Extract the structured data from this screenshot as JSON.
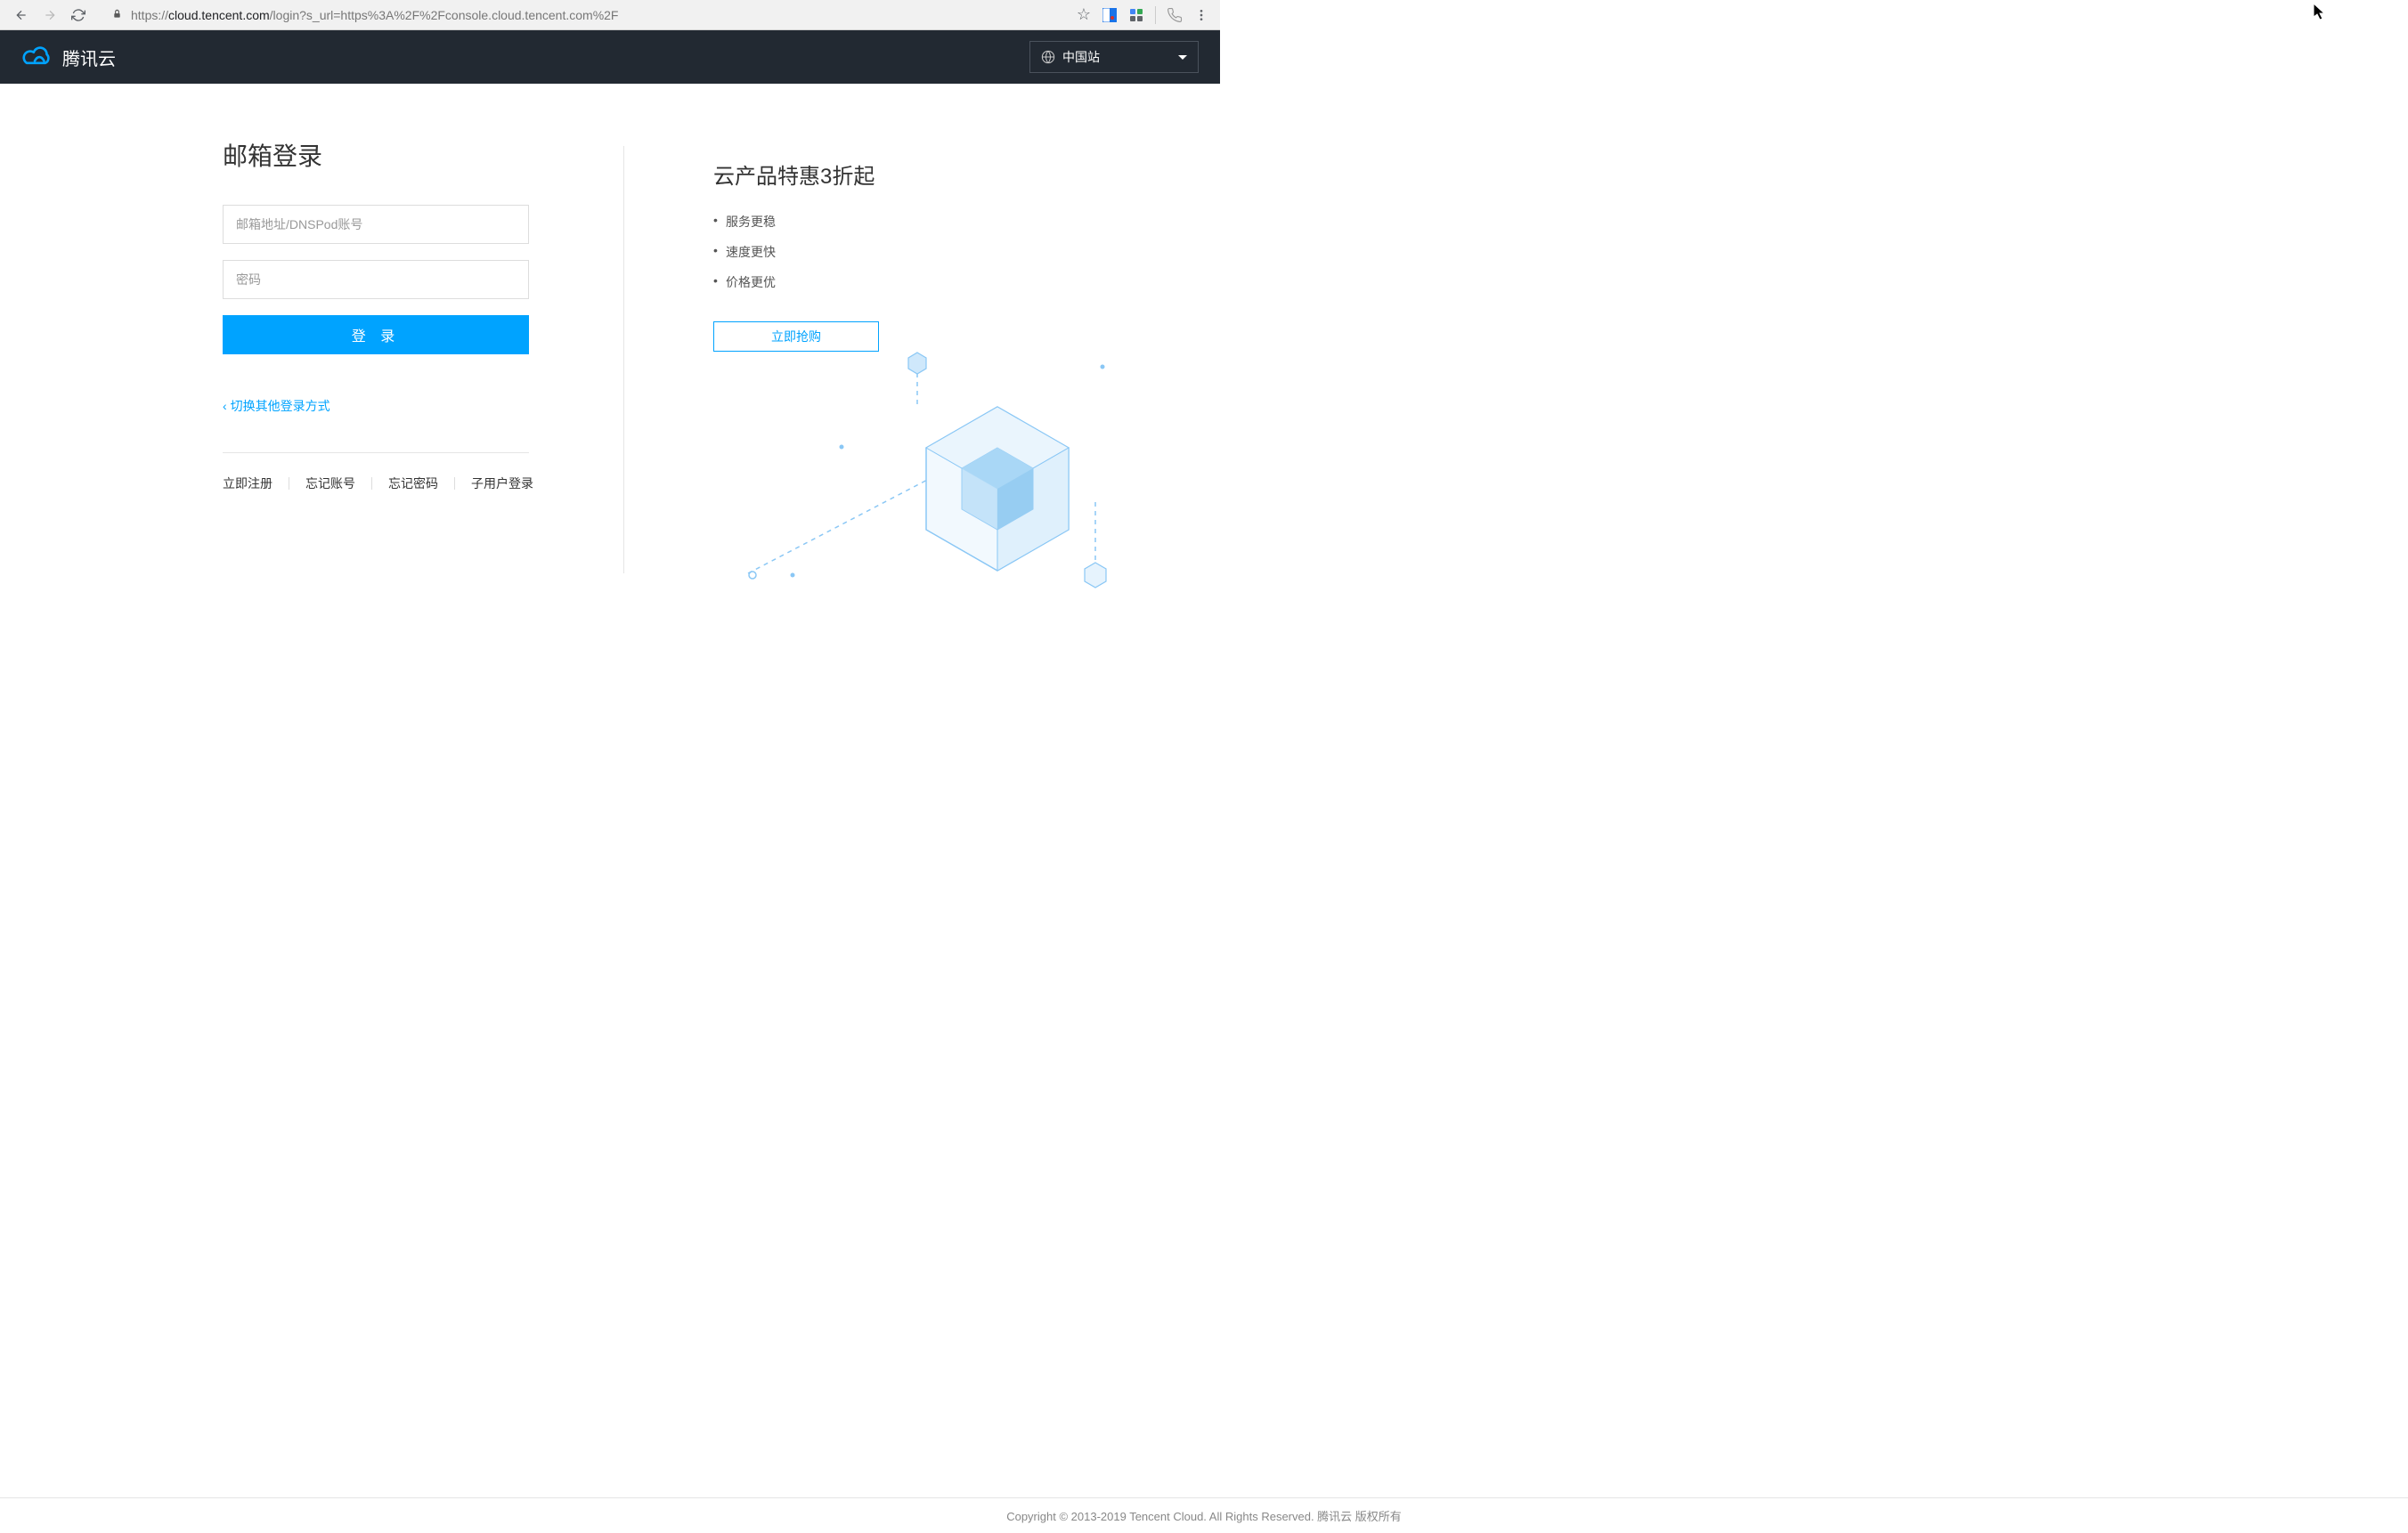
{
  "browser": {
    "url_prefix": "https://",
    "url_domain": "cloud.tencent.com",
    "url_path": "/login?s_url=https%3A%2F%2Fconsole.cloud.tencent.com%2F"
  },
  "header": {
    "brand": "腾讯云",
    "region": "中国站"
  },
  "login": {
    "title": "邮箱登录",
    "email_placeholder": "邮箱地址/DNSPod账号",
    "password_placeholder": "密码",
    "submit": "登 录",
    "switch": "切换其他登录方式",
    "links": {
      "register": "立即注册",
      "forgot_account": "忘记账号",
      "forgot_password": "忘记密码",
      "subuser": "子用户登录"
    }
  },
  "promo": {
    "title": "云产品特惠3折起",
    "bullets": [
      "服务更稳",
      "速度更快",
      "价格更优"
    ],
    "cta": "立即抢购"
  },
  "footer": {
    "text": "Copyright © 2013-2019 Tencent Cloud. All Rights Reserved. 腾讯云 版权所有"
  }
}
